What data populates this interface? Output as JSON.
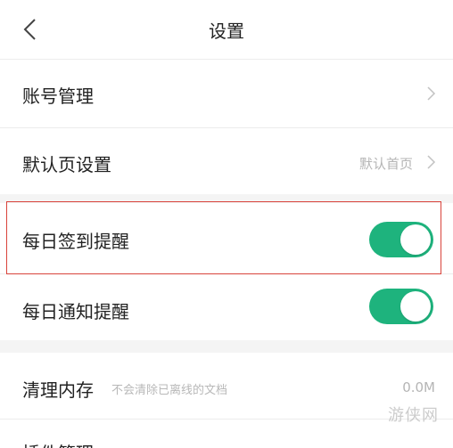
{
  "header": {
    "title": "设置"
  },
  "rows": {
    "account": {
      "label": "账号管理"
    },
    "default_page": {
      "label": "默认页设置",
      "value": "默认首页"
    },
    "daily_checkin": {
      "label": "每日签到提醒",
      "enabled": true
    },
    "daily_notify": {
      "label": "每日通知提醒",
      "enabled": true
    },
    "clear_cache": {
      "label": "清理内存",
      "hint": "不会清除已离线的文档",
      "value": "0.0M"
    },
    "plugin": {
      "label": "插件管理"
    }
  },
  "watermark": "游侠网",
  "colors": {
    "toggle_on": "#1eb37d",
    "highlight": "#d9433b",
    "section_gap": "#f4f4f4"
  }
}
